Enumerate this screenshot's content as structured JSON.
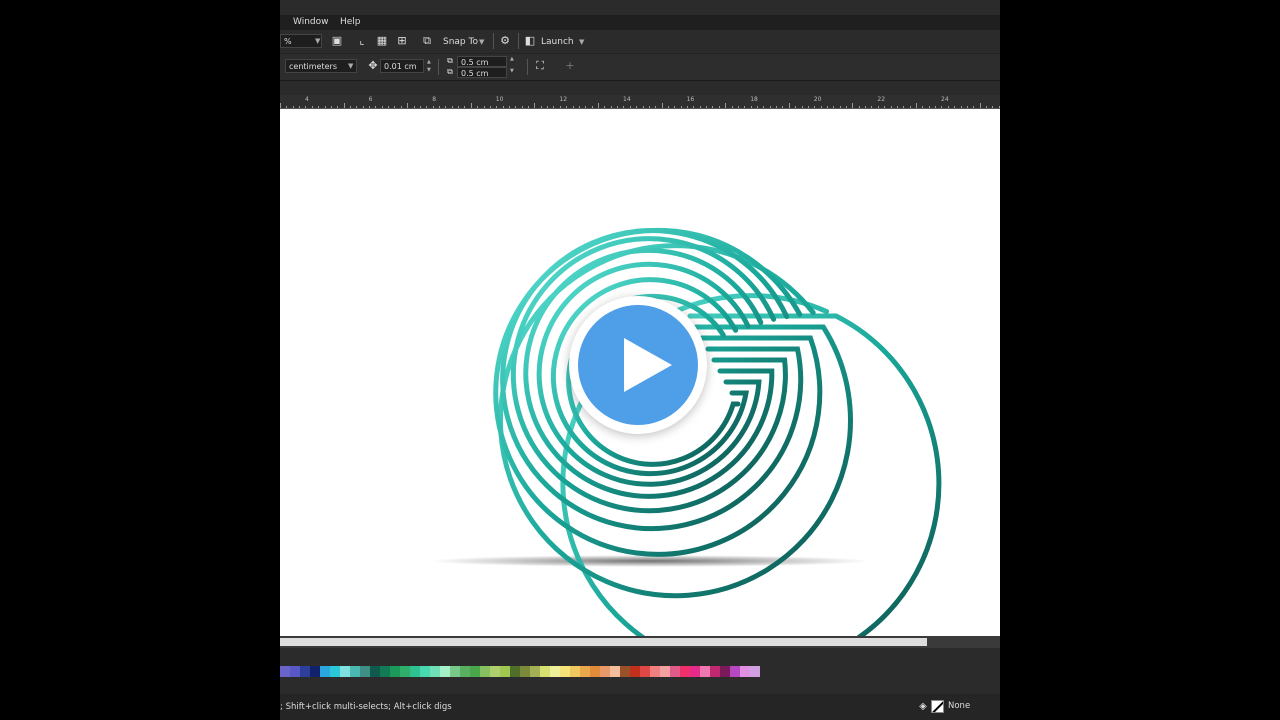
{
  "menu": {
    "items": [
      "Window",
      "Help"
    ]
  },
  "toolbar": {
    "zoom_value": "%",
    "snap_to": "Snap To",
    "launch": "Launch"
  },
  "properties": {
    "units": "centimeters",
    "nudge": "0.01 cm",
    "dup_x": "0.5 cm",
    "dup_y": "0.5 cm"
  },
  "ruler": {
    "labels": [
      "4",
      "6",
      "8",
      "10",
      "12",
      "14",
      "16",
      "18",
      "20",
      "22",
      "24"
    ]
  },
  "status": {
    "hint": "; Shift+click multi-selects; Alt+click digs",
    "fill": "None"
  },
  "colors": {
    "accent_play": "#4f9ee8",
    "teal": "#1aa89a",
    "teal_light": "#5fe3d5",
    "teal_dark": "#0b4f4a"
  },
  "palette": [
    "#6a63c9",
    "#5858c8",
    "#2c3f9b",
    "#11226b",
    "#29a8e0",
    "#29c7d8",
    "#7fe0e0",
    "#49b8b0",
    "#3f8f86",
    "#0f5a4c",
    "#127a54",
    "#1d9a5a",
    "#2eb06a",
    "#2ec290",
    "#49d9b0",
    "#6fe0b8",
    "#a6f0c8",
    "#79c98a",
    "#58b060",
    "#4aa64a",
    "#86c060",
    "#b0d070",
    "#a0c850",
    "#4e6e2a",
    "#7c8b3a",
    "#a4b055",
    "#d6e070",
    "#f0f09a",
    "#f5e37a",
    "#f0c860",
    "#e9a84a",
    "#e08a3a",
    "#e89a6a",
    "#f2c09a",
    "#9a5028",
    "#c0301c",
    "#e04848",
    "#f08080",
    "#f2a0a0",
    "#e05a8a",
    "#f0306a",
    "#e62a8a",
    "#f078b0",
    "#c02870",
    "#7a1a5a",
    "#b848c0",
    "#e090e0",
    "#d0a0e0"
  ],
  "canvas_icons": [
    "play-icon",
    "letter-g-logo"
  ]
}
